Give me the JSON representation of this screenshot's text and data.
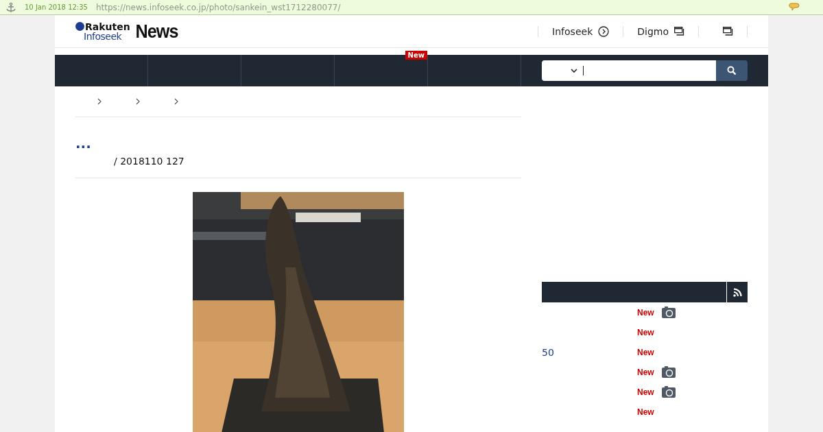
{
  "capture_bar": {
    "date": "10 Jan 2018 12:35",
    "url": "https://news.infoseek.co.jp/photo/sankein_wst1712280077/"
  },
  "header": {
    "logo": {
      "brand": "Rakuten",
      "sub": "Infoseek",
      "name": "News"
    },
    "links": [
      {
        "label": "Infoseek",
        "kind": "arrow"
      },
      {
        "label": "Digmo",
        "kind": "window"
      },
      {
        "kind": "window"
      }
    ]
  },
  "nav": {
    "new_badge": "New"
  },
  "article": {
    "title": "...",
    "meta": "/ 2018110 127",
    "photo": {
      "kind": "room-picture"
    }
  },
  "sidebar": {
    "items": [
      {
        "badge": "New",
        "photo": true
      },
      {
        "badge": "New",
        "photo": false
      },
      {
        "prefix": "50",
        "badge": "New",
        "photo": false
      },
      {
        "badge": "New",
        "photo": true
      },
      {
        "badge": "New",
        "photo": true
      },
      {
        "badge": "New",
        "photo": false
      }
    ]
  }
}
